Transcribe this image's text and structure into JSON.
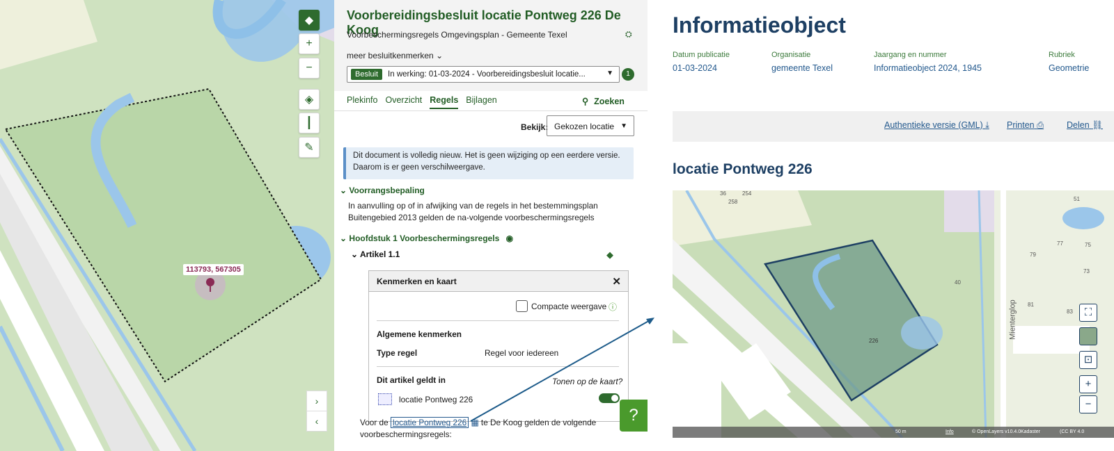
{
  "left_map": {
    "coord_label": "113793, 567305"
  },
  "plan": {
    "title": "Voorbereidingsbesluit locatie Pontweg 226 De Koog",
    "subtitle": "Voorbeschermingsregels Omgevingsplan - Gemeente Texel",
    "meer_label": "meer besluitkenmerken",
    "besluit_badge": "Besluit",
    "besluit_select": "In werking: 01-03-2024 - Voorbereidingsbesluit locatie...",
    "besluit_count": "1",
    "tabs": [
      "Plekinfo",
      "Overzicht",
      "Regels",
      "Bijlagen"
    ],
    "active_tab": "Regels",
    "zoeken": "Zoeken",
    "bekijk_label": "Bekijk:",
    "bekijk_value": "Gekozen locatie",
    "notice": "Dit document is volledig nieuw. Het is geen wijziging op een eerdere versie. Daarom is er geen verschilweergave.",
    "section1_title": "Voorrangsbepaling",
    "section1_text": "In aanvulling op of in afwijking van de regels in het bestemmingsplan Buitengebied 2013 gelden de na-volgende voorbeschermingsregels",
    "chapter_title": "Hoofdstuk 1 Voorbeschermingsregels",
    "article_title": "Artikel 1.1",
    "panel": {
      "title": "Kenmerken en kaart",
      "compact_label": "Compacte weergave",
      "general_heading": "Algemene kenmerken",
      "type_label": "Type regel",
      "type_value": "Regel voor iedereen",
      "applies_heading": "Dit artikel geldt in",
      "show_on_map": "Tonen op de kaart?",
      "location": "locatie Pontweg 226"
    },
    "bottom_prefix": "Voor de",
    "bottom_link": "locatie Pontweg 226",
    "bottom_suffix": "te De Koog gelden de volgende",
    "bottom_line2": "voorbeschermingsregels:"
  },
  "info": {
    "title": "Informatieobject",
    "meta": [
      {
        "label": "Datum publicatie",
        "value": "01-03-2024"
      },
      {
        "label": "Organisatie",
        "value": "gemeente Texel"
      },
      {
        "label": "Jaargang en nummer",
        "value": "Informatieobject 2024, 1945"
      },
      {
        "label": "Rubriek",
        "value": "Geometrie"
      }
    ],
    "actions": [
      "Authentieke versie (GML)",
      "Printen",
      "Delen"
    ],
    "subtitle": "locatie Pontweg 226",
    "map": {
      "street": "Mienterglop",
      "houses": [
        "51",
        "77",
        "75",
        "79",
        "73",
        "40",
        "81",
        "83",
        "226",
        "254",
        "258",
        "36"
      ],
      "attribution": [
        "50 m",
        "Info",
        "© OpenLayers v10.4.0",
        "Kadaster",
        "(CC BY 4.0"
      ]
    }
  }
}
